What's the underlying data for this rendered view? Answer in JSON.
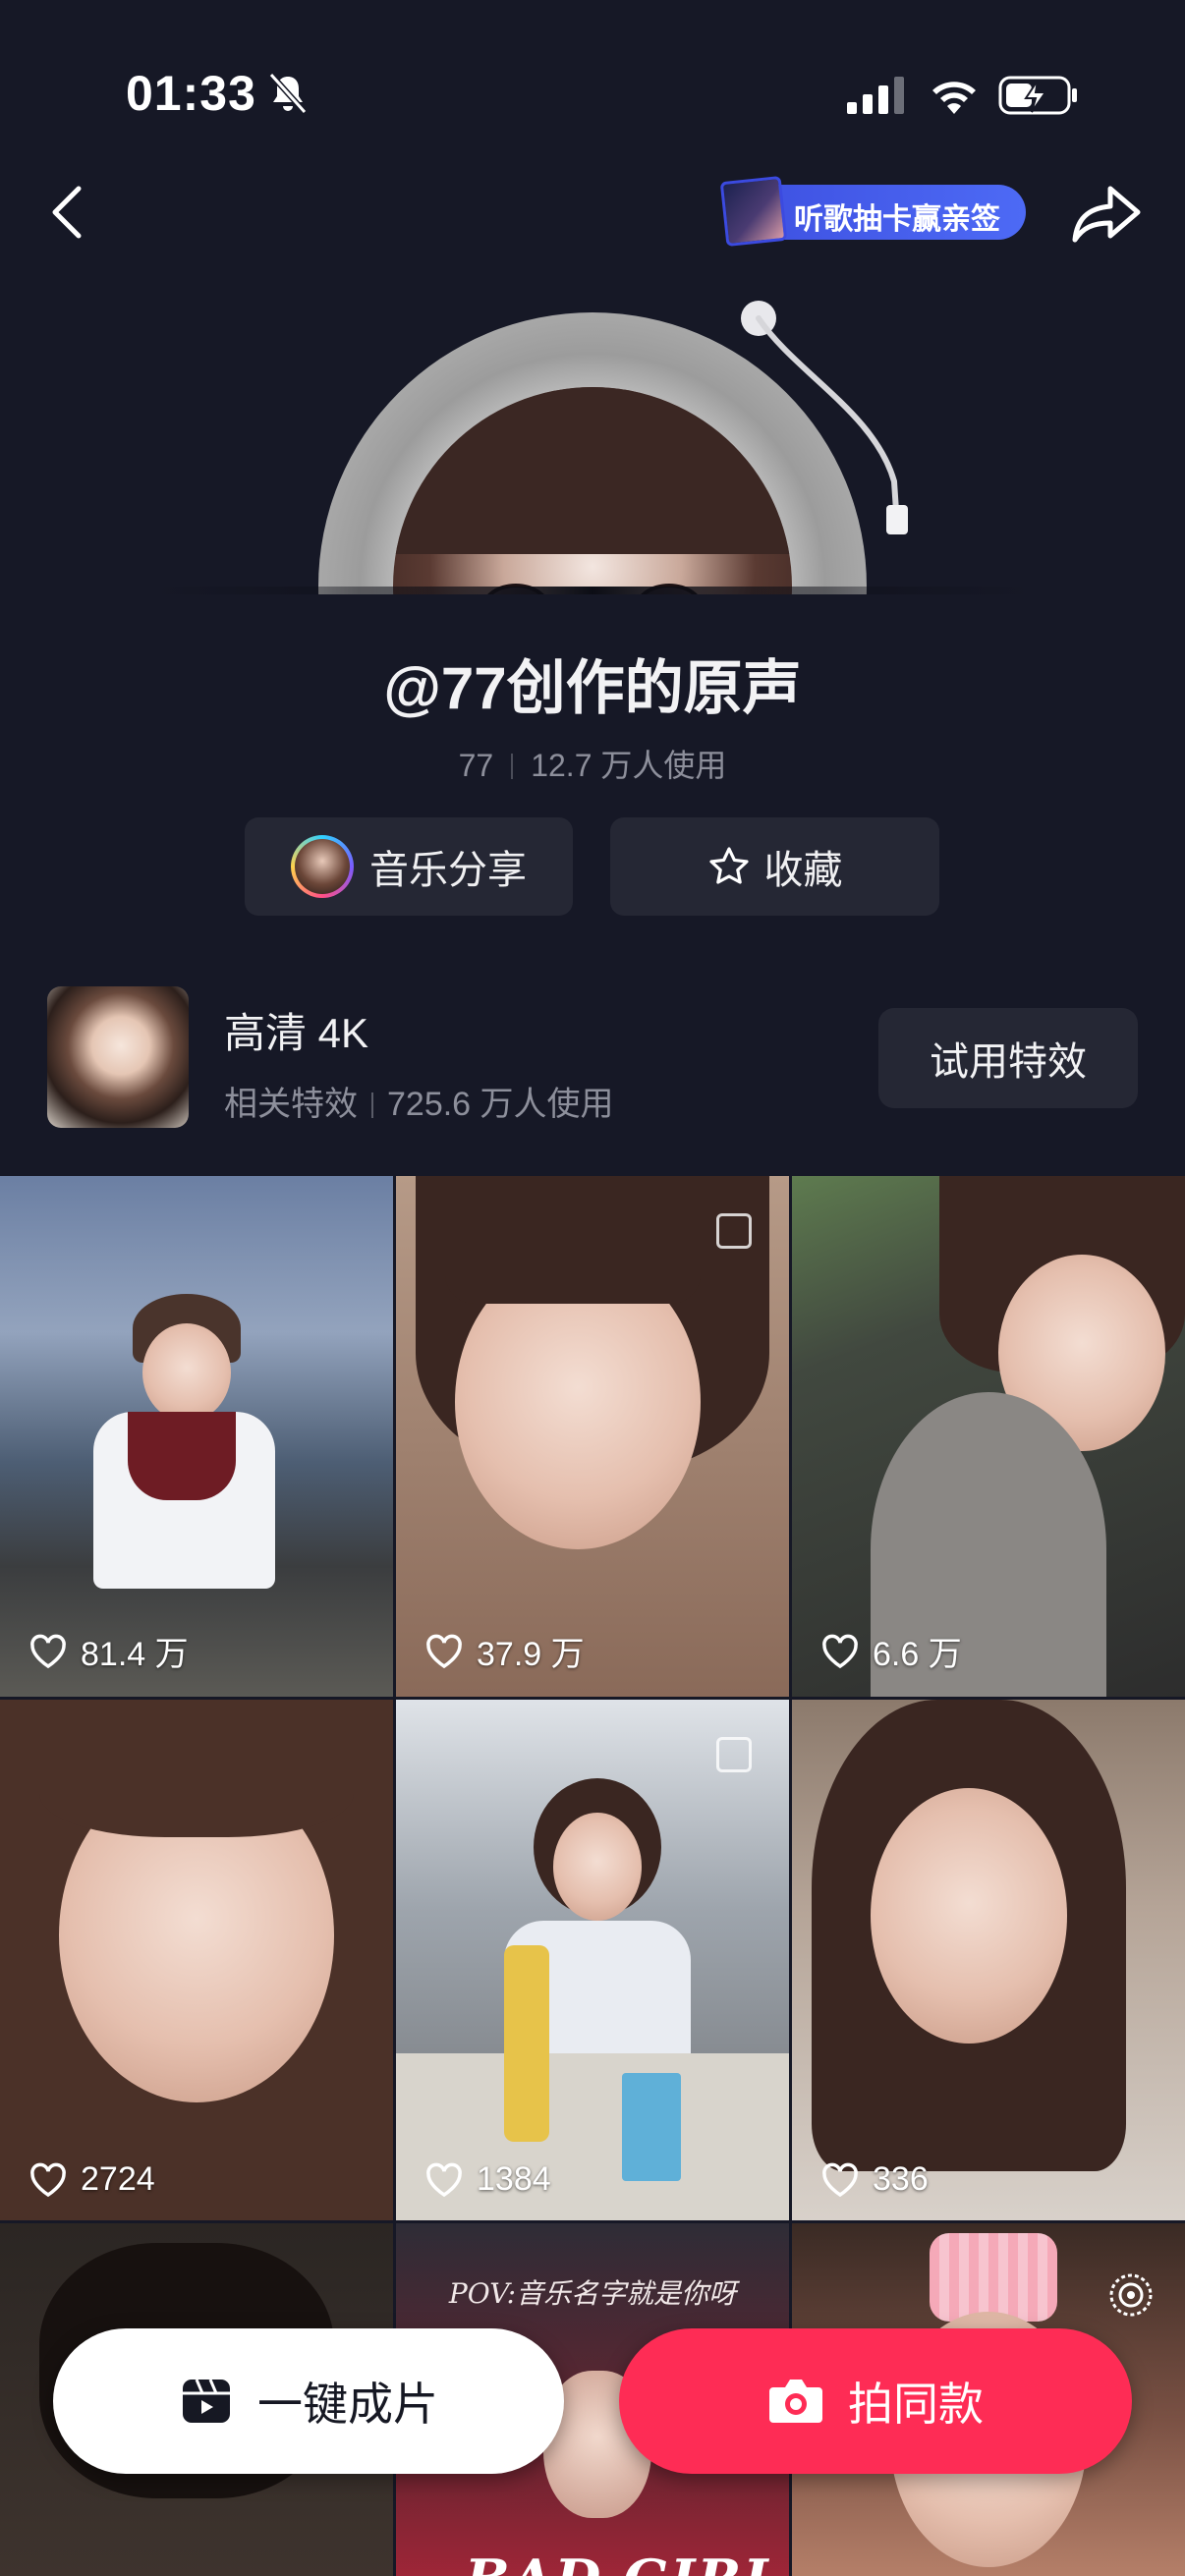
{
  "status_bar": {
    "time": "01:33"
  },
  "header": {
    "promo_label": "听歌抽卡赢亲签"
  },
  "music": {
    "title": "@77创作的原声",
    "author": "77",
    "usage": "12.7 万人使用",
    "share_label": "音乐分享",
    "favorite_label": "收藏"
  },
  "effect": {
    "name": "高清 4K",
    "category": "相关特效",
    "usage": "725.6 万人使用",
    "try_label": "试用特效"
  },
  "videos": [
    {
      "likes": "81.4 万"
    },
    {
      "likes": "37.9 万"
    },
    {
      "likes": "6.6 万"
    },
    {
      "likes": "2724"
    },
    {
      "likes": "1384"
    },
    {
      "likes": "336"
    }
  ],
  "poster": {
    "pov_text": "POV:音乐名字就是你呀",
    "title_text": "BAD GIRL"
  },
  "actions": {
    "one_click_label": "一键成片",
    "shoot_label": "拍同款"
  }
}
